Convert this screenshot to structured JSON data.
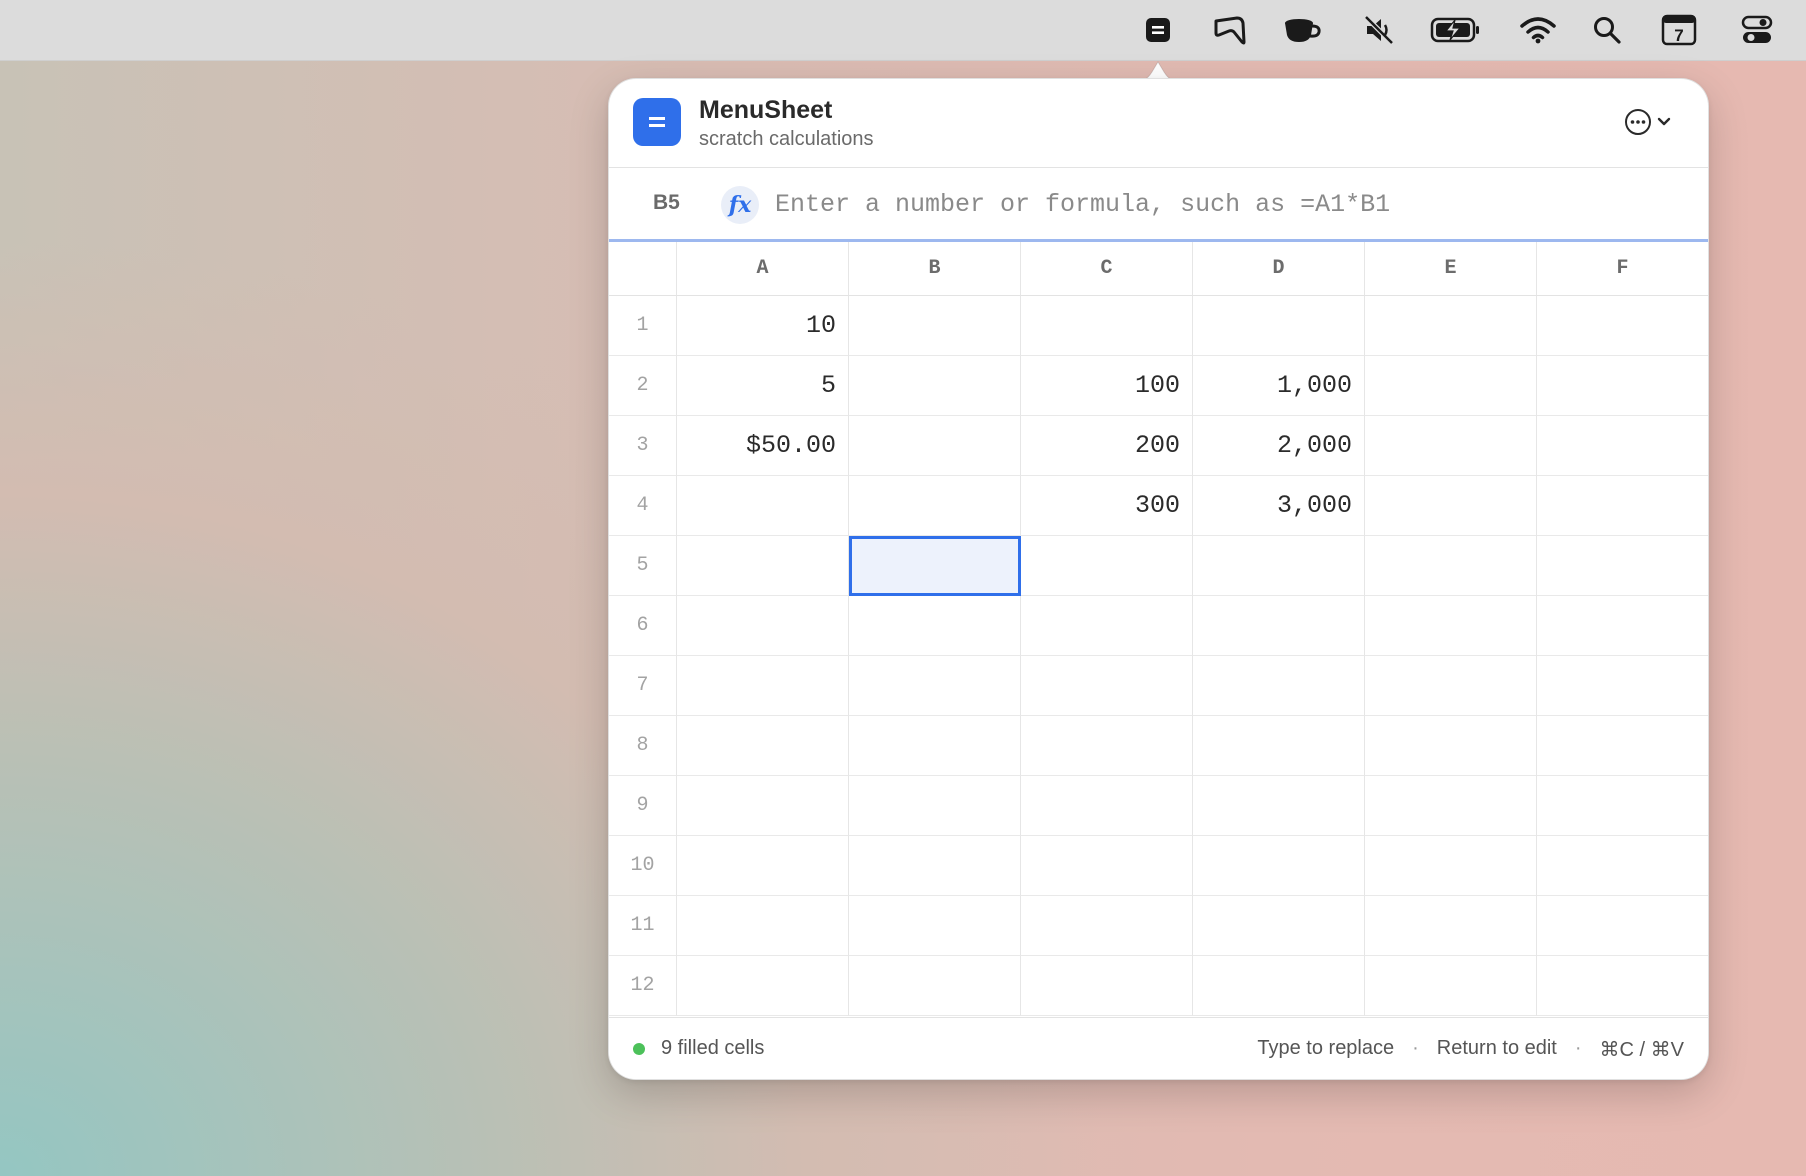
{
  "menubar": {
    "items": [
      {
        "name": "menusheet-icon"
      },
      {
        "name": "cursor-icon"
      },
      {
        "name": "coffee-cup-icon"
      },
      {
        "name": "mute-icon"
      },
      {
        "name": "battery-charging-icon"
      },
      {
        "name": "wifi-icon"
      },
      {
        "name": "search-icon"
      },
      {
        "name": "calendar-icon",
        "label": "7"
      },
      {
        "name": "control-center-icon"
      }
    ]
  },
  "app": {
    "icon_glyph": "=",
    "title": "MenuSheet",
    "subtitle": "scratch calculations",
    "accent": "#2f6fea"
  },
  "formula_bar": {
    "cell_ref": "B5",
    "fx_label": "fx",
    "value": "",
    "placeholder": "Enter a number or formula, such as =A1*B1"
  },
  "sheet": {
    "columns": [
      "A",
      "B",
      "C",
      "D",
      "E",
      "F"
    ],
    "rows": [
      "1",
      "2",
      "3",
      "4",
      "5",
      "6",
      "7",
      "8",
      "9",
      "10",
      "11",
      "12"
    ],
    "cells": [
      [
        "10",
        "",
        "",
        "",
        "",
        ""
      ],
      [
        "5",
        "",
        "100",
        "1,000",
        "",
        ""
      ],
      [
        "$50.00",
        "",
        "200",
        "2,000",
        "",
        ""
      ],
      [
        "",
        "",
        "300",
        "3,000",
        "",
        ""
      ],
      [
        "",
        "",
        "",
        "",
        "",
        ""
      ],
      [
        "",
        "",
        "",
        "",
        "",
        ""
      ],
      [
        "",
        "",
        "",
        "",
        "",
        ""
      ],
      [
        "",
        "",
        "",
        "",
        "",
        ""
      ],
      [
        "",
        "",
        "",
        "",
        "",
        ""
      ],
      [
        "",
        "",
        "",
        "",
        "",
        ""
      ],
      [
        "",
        "",
        "",
        "",
        "",
        ""
      ],
      [
        "",
        "",
        "",
        "",
        "",
        ""
      ]
    ],
    "selected": {
      "row": 5,
      "col": "B"
    }
  },
  "footer": {
    "status": "9 filled cells",
    "status_color": "#4cc15a",
    "hint_replace": "Type to replace",
    "hint_edit": "Return to edit",
    "hint_copy": "⌘C / ⌘V",
    "separator": "·"
  }
}
